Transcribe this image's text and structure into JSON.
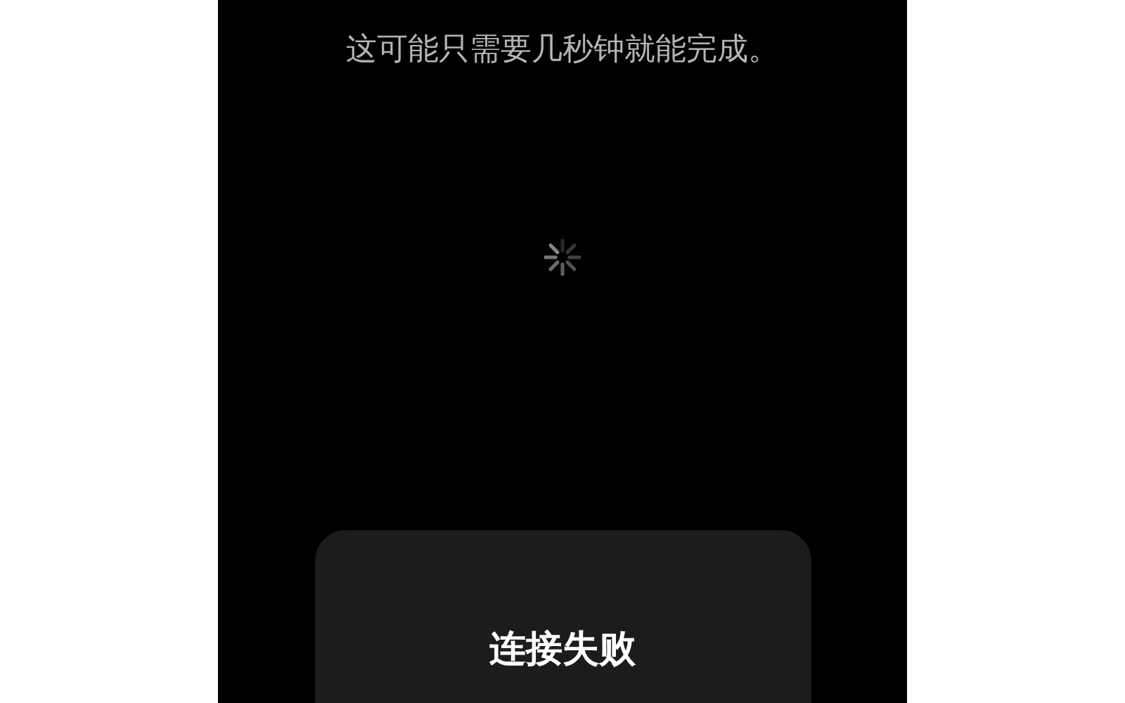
{
  "message": "这可能只需要几秒钟就能完成。",
  "alert": {
    "title": "连接失败"
  }
}
